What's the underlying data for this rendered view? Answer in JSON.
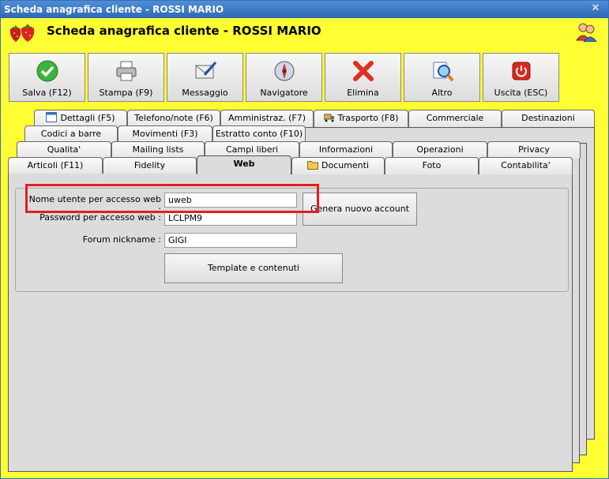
{
  "window": {
    "title": "Scheda anagrafica cliente - ROSSI MARIO",
    "close_glyph": "✕"
  },
  "header": {
    "title": "Scheda anagrafica cliente - ROSSI MARIO",
    "logo_icon": "strawberries-icon",
    "users_icon": "users-icon"
  },
  "toolbar": {
    "buttons": [
      {
        "label": "Salva (F12)",
        "icon": "check-icon"
      },
      {
        "label": "Stampa (F9)",
        "icon": "printer-icon"
      },
      {
        "label": "Messaggio",
        "icon": "mail-icon"
      },
      {
        "label": "Navigatore",
        "icon": "compass-icon"
      },
      {
        "label": "Elimina",
        "icon": "delete-x-icon"
      },
      {
        "label": "Altro",
        "icon": "magnifier-icon"
      },
      {
        "label": "Uscita (ESC)",
        "icon": "power-icon"
      }
    ]
  },
  "tabs": {
    "row1": [
      "Dettagli (F5)",
      "Telefono/note (F6)",
      "Amministraz. (F7)",
      "Trasporto (F8)",
      "Commerciale",
      "Destinazioni"
    ],
    "row2": [
      "Codici a barre",
      "Movimenti (F3)",
      "Estratto conto (F10)"
    ],
    "row3": [
      "Qualita'",
      "Mailing lists",
      "Campi liberi",
      "Informazioni",
      "Operazioni",
      "Privacy"
    ],
    "row4": [
      "Articoli (F11)",
      "Fidelity",
      "Web",
      "Documenti",
      "Foto",
      "Contabilita'"
    ],
    "active": "Web"
  },
  "web": {
    "username_label": "Nome utente per accesso web :",
    "username_value": "uweb",
    "password_label": "Password per accesso web :",
    "password_value": "LCLPM9",
    "nickname_label": "Forum nickname :",
    "nickname_value": "GIGI",
    "generate_button": "Genera nuovo account",
    "templates_button": "Template e contenuti"
  },
  "colors": {
    "background": "#ffff33",
    "titlebar": "#2d67b6",
    "highlight": "#e02020"
  }
}
